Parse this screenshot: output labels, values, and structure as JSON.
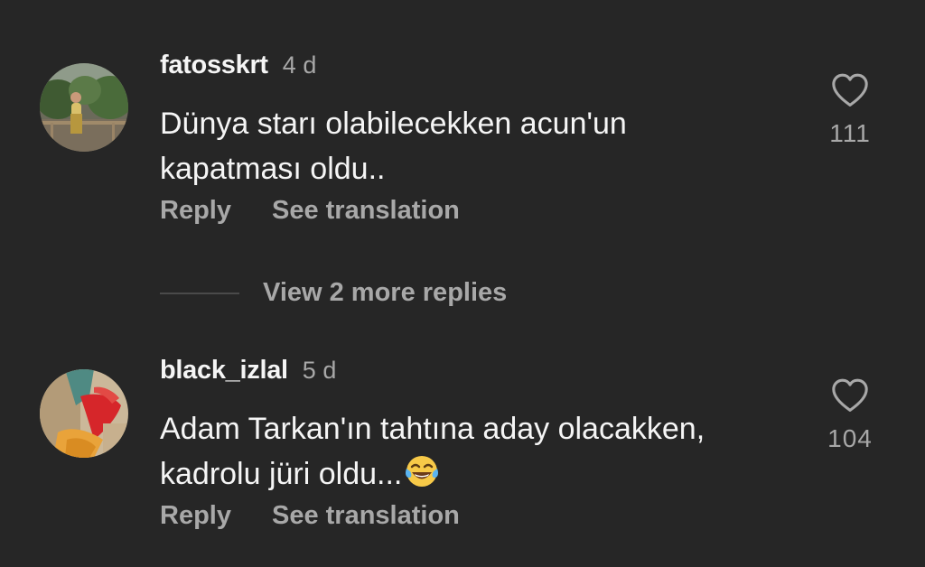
{
  "comments": [
    {
      "username": "fatosskrt",
      "time": "4 d",
      "text": "Dünya starı olabilecekken acun'un kapatması oldu..",
      "likes": "111",
      "reply_label": "Reply",
      "translate_label": "See translation",
      "avatar_icon": "avatar-photo-person-outdoors"
    },
    {
      "username": "black_izlal",
      "time": "5 d",
      "text": "Adam Tarkan'ın tahtına aday olacakken, kadrolu jüri oldu...",
      "emoji": "face-with-tears-of-joy-icon",
      "likes": "104",
      "reply_label": "Reply",
      "translate_label": "See translation",
      "avatar_icon": "avatar-photo-clothing"
    }
  ],
  "view_replies": {
    "label": "View 2 more replies"
  },
  "colors": {
    "background": "#262626",
    "primary_text": "#f5f5f5",
    "secondary_text": "#a8a8a8"
  }
}
